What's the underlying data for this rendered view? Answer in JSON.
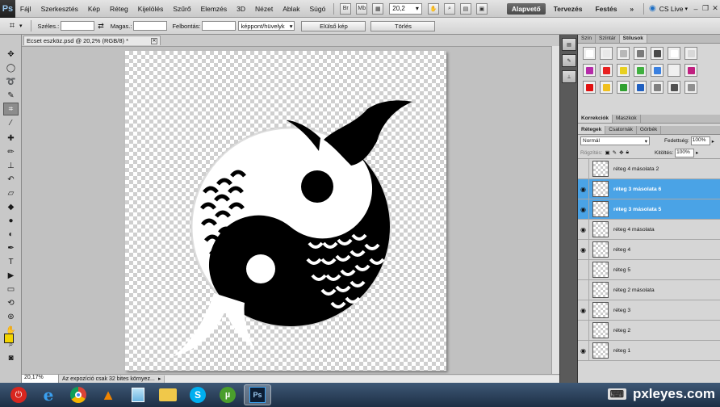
{
  "app": {
    "logo": "Ps"
  },
  "menubar": {
    "items": [
      "Fájl",
      "Szerkesztés",
      "Kép",
      "Réteg",
      "Kijelölés",
      "Szűrő",
      "Elemzés",
      "3D",
      "Nézet",
      "Ablak",
      "Súgó"
    ],
    "zoom": "20,2",
    "workspaces": [
      "Alapvető",
      "Tervezés",
      "Festés"
    ],
    "active_workspace": "Alapvető",
    "cs_live": "CS Live"
  },
  "options": {
    "width_label": "Széles.:",
    "height_label": "Magas.:",
    "resolution_label": "Felbontás:",
    "unit": "képpont/hüvelyk",
    "front_image_button": "Elülső kép",
    "clear_button": "Törlés"
  },
  "document": {
    "tab_title": "Ecset eszköz.psd @ 20,2% (RGB/8) *",
    "status_zoom": "20,17%",
    "status_info": "Az expozíció csak 32 bites környez..."
  },
  "panels": {
    "top_tabs": [
      "Szín",
      "Színtár",
      "Stílusok"
    ],
    "top_active": "Stílusok",
    "style_colors": [
      "#ffffff",
      "#e8e8e8",
      "#b8b8b8",
      "#7a7a7a",
      "#4a4a4a",
      "#ffffff",
      "#d8d8d8",
      "#b52aa8",
      "#e82020",
      "#e8d020",
      "#40b040",
      "#3a80e0",
      "#f0f0f0",
      "#c02080",
      "#e01010",
      "#f0c020",
      "#30a030",
      "#2060c0",
      "#808080",
      "#505050",
      "#909090"
    ],
    "adjust_tabs": [
      "Korrekciók",
      "Maszkok"
    ],
    "layers_tabs": [
      "Rétegek",
      "Csatornák",
      "Görbék"
    ],
    "blend_mode": "Normál",
    "opacity_label": "Fedettség:",
    "opacity_value": "100%",
    "lock_label": "Rögzítés:",
    "fill_label": "Kitöltés:",
    "fill_value": "100%"
  },
  "layers": [
    {
      "name": "réteg 4 másolata 2",
      "visible": false,
      "selected": false
    },
    {
      "name": "réteg 3 másolata 6",
      "visible": true,
      "selected": true
    },
    {
      "name": "réteg 3 másolata 5",
      "visible": true,
      "selected": true
    },
    {
      "name": "réteg 4 másolata",
      "visible": true,
      "selected": false
    },
    {
      "name": "réteg 4",
      "visible": true,
      "selected": false
    },
    {
      "name": "réteg 5",
      "visible": false,
      "selected": false
    },
    {
      "name": "réteg 2 másolata",
      "visible": false,
      "selected": false
    },
    {
      "name": "réteg 3",
      "visible": true,
      "selected": false
    },
    {
      "name": "réteg 2",
      "visible": false,
      "selected": false
    },
    {
      "name": "réteg 1",
      "visible": true,
      "selected": false
    }
  ],
  "taskbar": {
    "apps": [
      "power-icon",
      "ie-icon",
      "chrome-icon",
      "vlc-icon",
      "notes-icon",
      "folder-icon",
      "skype-icon",
      "utorrent-icon",
      "photoshop-icon"
    ]
  },
  "watermark": "pxleyes.com"
}
